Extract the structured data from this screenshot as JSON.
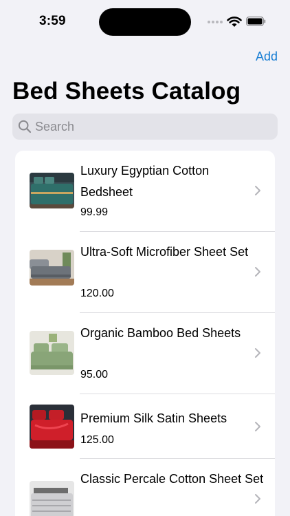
{
  "status_bar": {
    "time": "3:59"
  },
  "nav": {
    "add_label": "Add",
    "title": "Bed Sheets Catalog"
  },
  "search": {
    "placeholder": "Search",
    "value": ""
  },
  "items": [
    {
      "name": "Luxury Egyptian Cotton Bedsheet",
      "price": "99.99"
    },
    {
      "name": "Ultra-Soft Microfiber Sheet Set",
      "price": "120.00"
    },
    {
      "name": "Organic Bamboo Bed Sheets",
      "price": "95.00"
    },
    {
      "name": "Premium Silk Satin Sheets",
      "price": "125.00"
    },
    {
      "name": "Classic Percale Cotton Sheet Set",
      "price": ""
    }
  ],
  "colors": {
    "accent": "#1a7fd4",
    "background": "#f2f2f7"
  }
}
